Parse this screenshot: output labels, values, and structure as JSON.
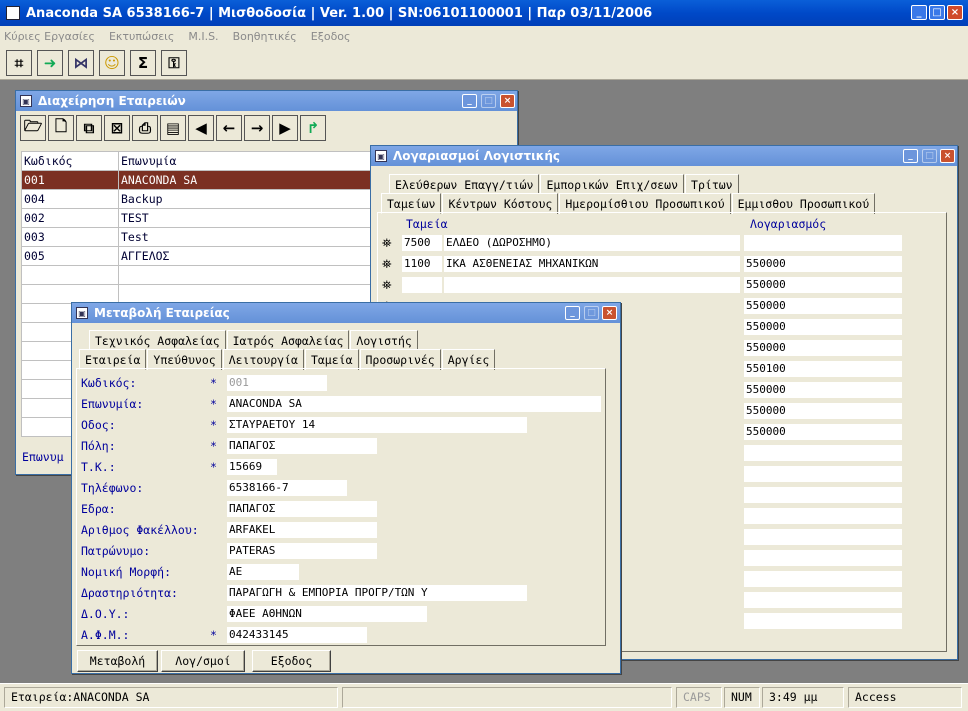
{
  "app": {
    "title": "Anaconda SA 6538166-7 | Μισθοδοσία | Ver. 1.00 | SN:06101100001 | Παρ 03/11/2006"
  },
  "menu": [
    "Κύριες Εργασίες",
    "Εκτυπώσεις",
    "M.I.S.",
    "Βοηθητικές",
    "Εξοδος"
  ],
  "toolbar": {
    "icons": [
      "hierarchy-icon",
      "transfer-icon",
      "network-icon",
      "smiley-icon",
      "sigma-icon",
      "key-icon"
    ],
    "sigma": "Σ"
  },
  "companies": {
    "title": "Διαχείρηση Εταιρειών",
    "col_code": "Κωδικός",
    "col_name": "Επωνυμία",
    "rows": [
      {
        "code": "001",
        "name": "ANACONDA SA"
      },
      {
        "code": "004",
        "name": "Backup"
      },
      {
        "code": "002",
        "name": "TEST"
      },
      {
        "code": "003",
        "name": "Test"
      },
      {
        "code": "005",
        "name": "ΑΓΓΕΛΟΣ"
      }
    ],
    "footer_label": "Επωνυμ"
  },
  "accounts": {
    "title": "Λογαριασμοί Λογιστικής",
    "tabs_top": [
      "Ελεύθερων Επαγγ/τιών",
      "Εμπορικών Επιχ/σεων",
      "Τρίτων"
    ],
    "tabs_bottom": [
      "Ταμείων",
      "Κέντρων Κόστους",
      "Ημερομίσθιου Προσωπικού",
      "Εμμισθου Προσωπικού"
    ],
    "col_fund": "Ταμεία",
    "col_account": "Λογαριασμός",
    "rows": [
      {
        "code": "7500",
        "name": "ΕΛΔΕΟ (ΔΩΡΟΣΗΜΟ)",
        "account": ""
      },
      {
        "code": "1100",
        "name": "ΙΚΑ ΑΣΘΕΝΕΙΑΣ ΜΗΧΑΝΙΚΩΝ",
        "account": "550000"
      },
      {
        "code": "",
        "name": "",
        "account": "550000"
      },
      {
        "code": "",
        "name": "",
        "account": "550000"
      },
      {
        "code": "",
        "name": "",
        "account": "550000"
      },
      {
        "code": "",
        "name": "",
        "account": "550000"
      },
      {
        "code": "",
        "name": "",
        "account": "550100"
      },
      {
        "code": "",
        "name": "",
        "account": "550000"
      },
      {
        "code": "",
        "name": "",
        "account": "550000"
      },
      {
        "code": "",
        "name": "",
        "account": "550000"
      }
    ]
  },
  "company_edit": {
    "title": "Μεταβολή Εταιρείας",
    "tabs_top": [
      "Τεχνικός Ασφαλείας",
      "Ιατρός Ασφαλείας",
      "Λογιστής"
    ],
    "tabs_bottom": [
      "Εταιρεία",
      "Υπεύθυνος",
      "Λειτουργία",
      "Ταμεία",
      "Προσωρινές",
      "Αργίες"
    ],
    "fields": [
      {
        "label": "Κωδικός:",
        "req": "*",
        "value": "001"
      },
      {
        "label": "Επωνυμία:",
        "req": "*",
        "value": "ANACONDA SA"
      },
      {
        "label": "Οδος:",
        "req": "*",
        "value": "ΣΤΑΥΡΑΕΤΟΥ 14"
      },
      {
        "label": "Πόλη:",
        "req": "*",
        "value": "ΠΑΠΑΓΟΣ"
      },
      {
        "label": "Τ.Κ.:",
        "req": "*",
        "value": "15669"
      },
      {
        "label": "Τηλέφωνο:",
        "req": "",
        "value": "6538166-7"
      },
      {
        "label": "Εδρα:",
        "req": "",
        "value": "ΠΑΠΑΓΟΣ"
      },
      {
        "label": "Αριθμος Φακέλλου:",
        "req": "",
        "value": "ARFAKEL"
      },
      {
        "label": "Πατρώνυμο:",
        "req": "",
        "value": "PATERAS"
      },
      {
        "label": "Νομική Μορφή:",
        "req": "",
        "value": "ΑΕ"
      },
      {
        "label": "Δραστηριότητα:",
        "req": "",
        "value": "ΠΑΡΑΓΩΓΗ & ΕΜΠΟΡΙΑ ΠΡΟΓΡ/ΤΩΝ Υ"
      },
      {
        "label": "Δ.Ο.Υ.:",
        "req": "",
        "value": "ΦΑΕΕ ΑΘΗΝΩΝ"
      },
      {
        "label": "Α.Φ.Μ.:",
        "req": "*",
        "value": "042433145"
      }
    ],
    "buttons": {
      "change": "Μεταβολή",
      "accounts": "Λογ/σμοί",
      "exit": "Εξοδος"
    }
  },
  "status": {
    "company": "Εταιρεία:ANACONDA SA",
    "caps": "CAPS",
    "num": "NUM",
    "time": "3:49 μμ",
    "db": "Access"
  }
}
